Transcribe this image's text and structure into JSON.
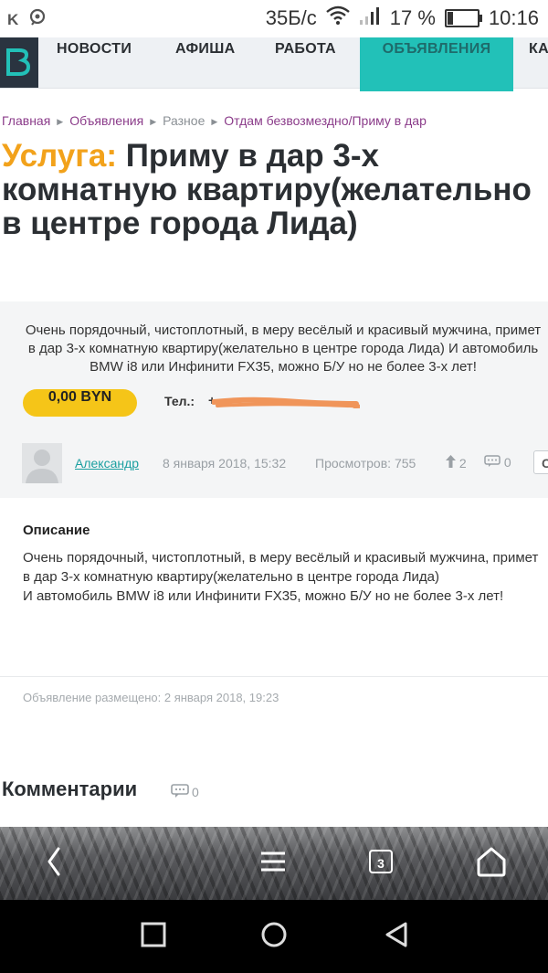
{
  "status_bar": {
    "app_icon": "K",
    "speed": "35Б/с",
    "battery": "17 %",
    "battery_level": 0.17,
    "time": "10:16",
    "icons": [
      "vk-icon",
      "messenger-icon",
      "wifi-icon",
      "signal-icon",
      "battery-icon"
    ]
  },
  "nav": {
    "items": [
      "НОВОСТИ",
      "АФИША",
      "РАБОТА",
      "ОБЪЯВЛЕНИЯ",
      "КА"
    ],
    "active_index": 3
  },
  "breadcrumb": {
    "items": [
      "Главная",
      "Объявления",
      "Разное",
      "Отдам безвозмездно/Приму в дар"
    ]
  },
  "ad": {
    "kind": "Услуга:",
    "title": "Приму в дар 3-х комнатную квартиру(желательно в центре города Лида)",
    "summary": "Очень порядочный, чистоплотный, в меру весёлый и красивый мужчина, примет в дар 3-х комнатную квартиру(желательно в центре города Лида) И автомобиль BMW i8 или Инфинити FX35, можно Б/У но не более 3-х лет!",
    "price": "0,00 BYN",
    "tel_label": "Тел.:",
    "tel_value": "+",
    "author": "Александр",
    "date": "8 января 2018, 15:32",
    "views": "Просмотров: 755",
    "votes": "2",
    "comments": "0",
    "button_label": "С"
  },
  "description": {
    "heading": "Описание",
    "text": "Очень порядочный, чистоплотный, в меру весёлый и красивый мужчина, примет в дар 3-х комнатную квартиру(желательно в центре города Лида)\nИ автомобиль BMW i8 или Инфинити FX35, можно Б/У но не более 3-х лет!",
    "posted": "Объявление размещено: 2 января 2018, 19:23"
  },
  "comments": {
    "heading": "Комментарии",
    "count": "0"
  },
  "browser_bar": {
    "tabs_count": "3",
    "icons": [
      "back-icon",
      "menu-icon",
      "tabs-icon",
      "home-icon"
    ]
  },
  "android_nav": {
    "icons": [
      "recent-apps-icon",
      "home-circle-icon",
      "back-triangle-icon"
    ]
  },
  "colors": {
    "accent_teal": "#22c1b8",
    "title_orange": "#f2a21b",
    "price_yellow": "#f5c518",
    "link_purple": "#8b3c8a",
    "scribble_orange": "#f0955a"
  }
}
